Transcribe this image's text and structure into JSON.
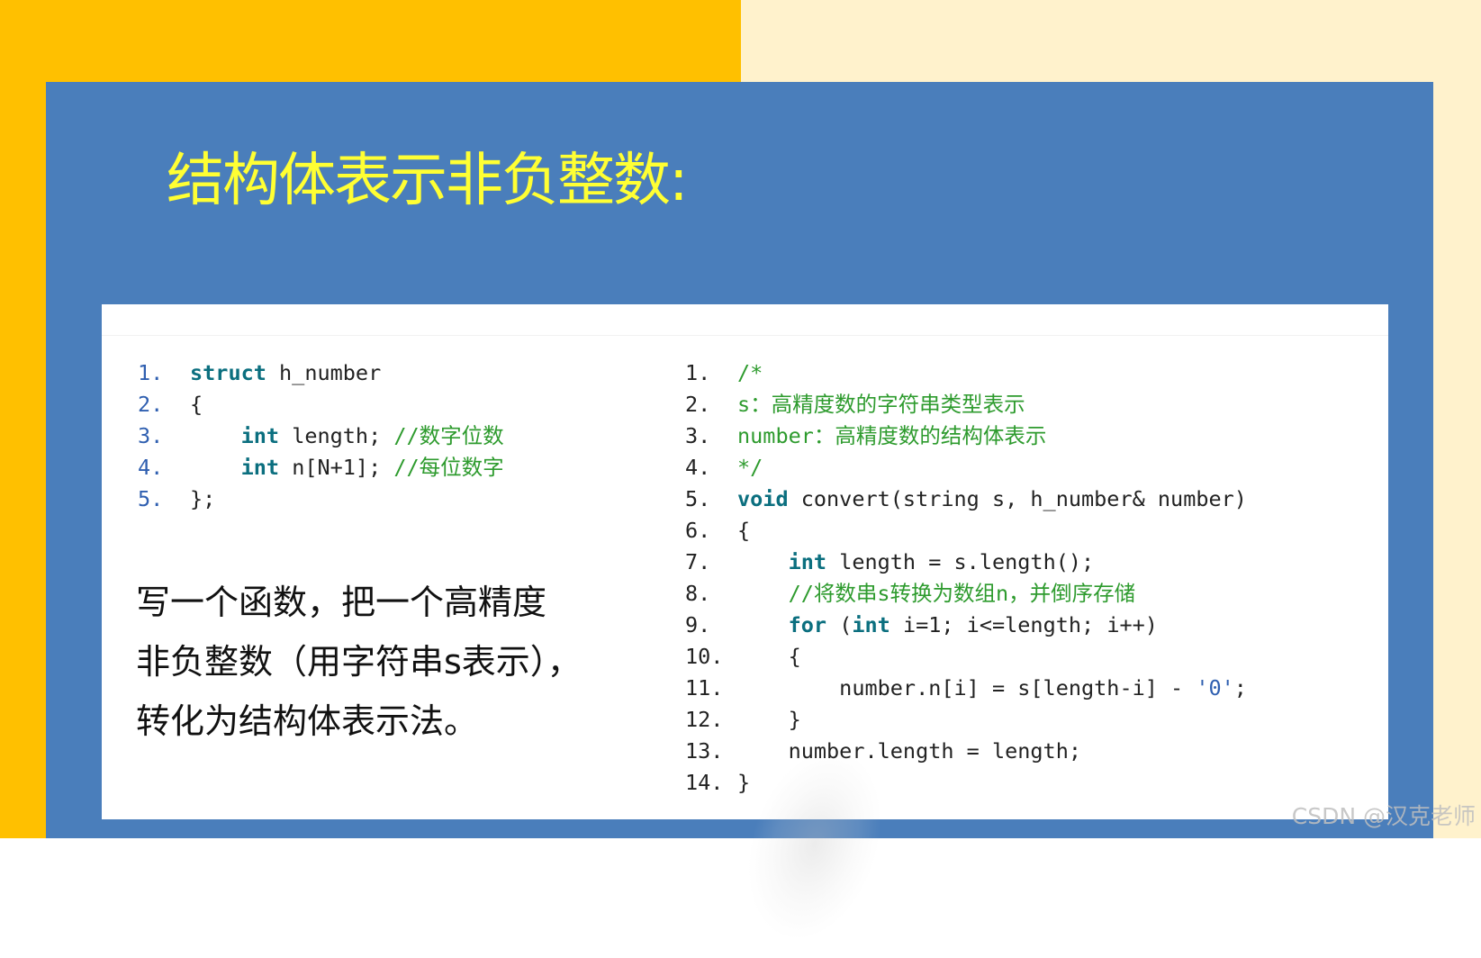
{
  "slide": {
    "title": "结构体表示非负整数:"
  },
  "left_code": [
    {
      "num": "1.",
      "parts": [
        {
          "t": "struct",
          "c": "kw"
        },
        {
          "t": " h_number"
        }
      ]
    },
    {
      "num": "2.",
      "parts": [
        {
          "t": "{"
        }
      ]
    },
    {
      "num": "3.",
      "parts": [
        {
          "t": "    "
        },
        {
          "t": "int",
          "c": "kw"
        },
        {
          "t": " length; "
        },
        {
          "t": "//数字位数",
          "c": "cm"
        }
      ]
    },
    {
      "num": "4.",
      "parts": [
        {
          "t": "    "
        },
        {
          "t": "int",
          "c": "kw"
        },
        {
          "t": " n[N+1]; "
        },
        {
          "t": "//每位数字",
          "c": "cm"
        }
      ]
    },
    {
      "num": "5.",
      "parts": [
        {
          "t": "};"
        }
      ]
    }
  ],
  "task_lines": [
    "写一个函数，把一个高精度",
    "非负整数（用字符串s表示），",
    "转化为结构体表示法。"
  ],
  "right_code": [
    {
      "num": "1.",
      "parts": [
        {
          "t": "/*",
          "c": "cm"
        }
      ]
    },
    {
      "num": "2.",
      "parts": [
        {
          "t": "s：高精度数的字符串类型表示",
          "c": "cm"
        }
      ]
    },
    {
      "num": "3.",
      "parts": [
        {
          "t": "number：高精度数的结构体表示",
          "c": "cm"
        }
      ]
    },
    {
      "num": "4.",
      "parts": [
        {
          "t": "*/",
          "c": "cm"
        }
      ]
    },
    {
      "num": "5.",
      "parts": [
        {
          "t": "void",
          "c": "kw"
        },
        {
          "t": " convert(string s, h_number& number)"
        }
      ]
    },
    {
      "num": "6.",
      "parts": [
        {
          "t": "{"
        }
      ]
    },
    {
      "num": "7.",
      "parts": [
        {
          "t": "    "
        },
        {
          "t": "int",
          "c": "kw"
        },
        {
          "t": " length = s.length();"
        }
      ]
    },
    {
      "num": "8.",
      "parts": [
        {
          "t": "    "
        },
        {
          "t": "//将数串s转换为数组n，并倒序存储",
          "c": "cm"
        }
      ]
    },
    {
      "num": "9.",
      "parts": [
        {
          "t": "    "
        },
        {
          "t": "for",
          "c": "kw"
        },
        {
          "t": " ("
        },
        {
          "t": "int",
          "c": "kw"
        },
        {
          "t": " i=1; i<=length; i++)"
        }
      ]
    },
    {
      "num": "10.",
      "parts": [
        {
          "t": "    {"
        }
      ]
    },
    {
      "num": "11.",
      "parts": [
        {
          "t": "        number.n[i] = s[length-i] - "
        },
        {
          "t": "'0'",
          "c": "str"
        },
        {
          "t": ";"
        }
      ]
    },
    {
      "num": "12.",
      "parts": [
        {
          "t": "    }"
        }
      ]
    },
    {
      "num": "13.",
      "parts": [
        {
          "t": "    number.length = length;"
        }
      ]
    },
    {
      "num": "14.",
      "parts": [
        {
          "t": "}"
        }
      ]
    }
  ],
  "watermark": "CSDN @汉克老师",
  "colors": {
    "left_background": "#FFC000",
    "right_background": "#FFF2CC",
    "panel": "#4A7EBB",
    "title": "#FFFF33",
    "keyword": "#0B6F7F",
    "comment": "#2E9B2E",
    "line_number_left": "#2F5FB0"
  }
}
